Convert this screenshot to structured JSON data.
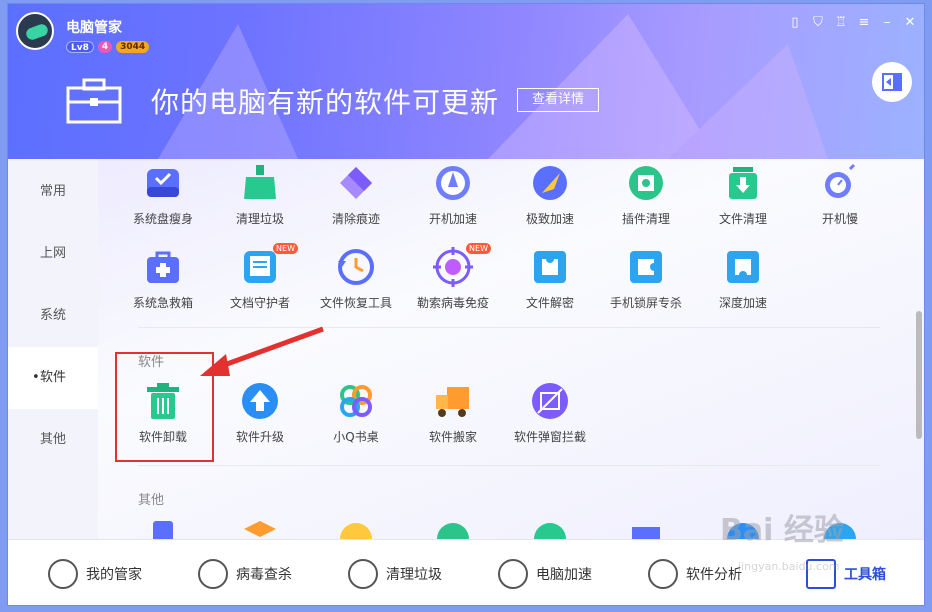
{
  "app": {
    "title": "电脑管家",
    "badges": [
      "Lv8",
      "4",
      "3044"
    ]
  },
  "window_controls": [
    "phone-icon",
    "shield-icon",
    "shirt-icon",
    "menu-icon",
    "minimize-icon",
    "close-icon"
  ],
  "banner": {
    "text": "你的电脑有新的软件可更新",
    "detail_btn": "查看详情"
  },
  "sidebar": {
    "items": [
      {
        "label": "常用"
      },
      {
        "label": "上网"
      },
      {
        "label": "系统"
      },
      {
        "label": "软件"
      },
      {
        "label": "其他"
      }
    ]
  },
  "tools_row1": [
    {
      "label": "系统盘瘦身"
    },
    {
      "label": "清理垃圾"
    },
    {
      "label": "清除痕迹"
    },
    {
      "label": "开机加速"
    },
    {
      "label": "极致加速"
    },
    {
      "label": "插件清理"
    },
    {
      "label": "文件清理"
    },
    {
      "label": "开机慢"
    }
  ],
  "tools_row2": [
    {
      "label": "系统急救箱"
    },
    {
      "label": "文档守护者",
      "badge": "NEW"
    },
    {
      "label": "文件恢复工具"
    },
    {
      "label": "勒索病毒免疫",
      "badge": "NEW"
    },
    {
      "label": "文件解密"
    },
    {
      "label": "手机锁屏专杀"
    },
    {
      "label": "深度加速"
    }
  ],
  "section_software": {
    "title": "软件",
    "tools": [
      {
        "label": "软件卸载"
      },
      {
        "label": "软件升级"
      },
      {
        "label": "小Q书桌"
      },
      {
        "label": "软件搬家"
      },
      {
        "label": "软件弹窗拦截"
      }
    ]
  },
  "section_other": {
    "title": "其他"
  },
  "bottom_nav": [
    {
      "label": "我的管家"
    },
    {
      "label": "病毒查杀"
    },
    {
      "label": "清理垃圾"
    },
    {
      "label": "电脑加速"
    },
    {
      "label": "软件分析"
    },
    {
      "label": "工具箱"
    }
  ],
  "watermark": {
    "main": "Bai 经验",
    "sub": "jingyan.baidu.com"
  },
  "colors": {
    "accent": "#5b6fff",
    "highlight": "#e3312f"
  }
}
